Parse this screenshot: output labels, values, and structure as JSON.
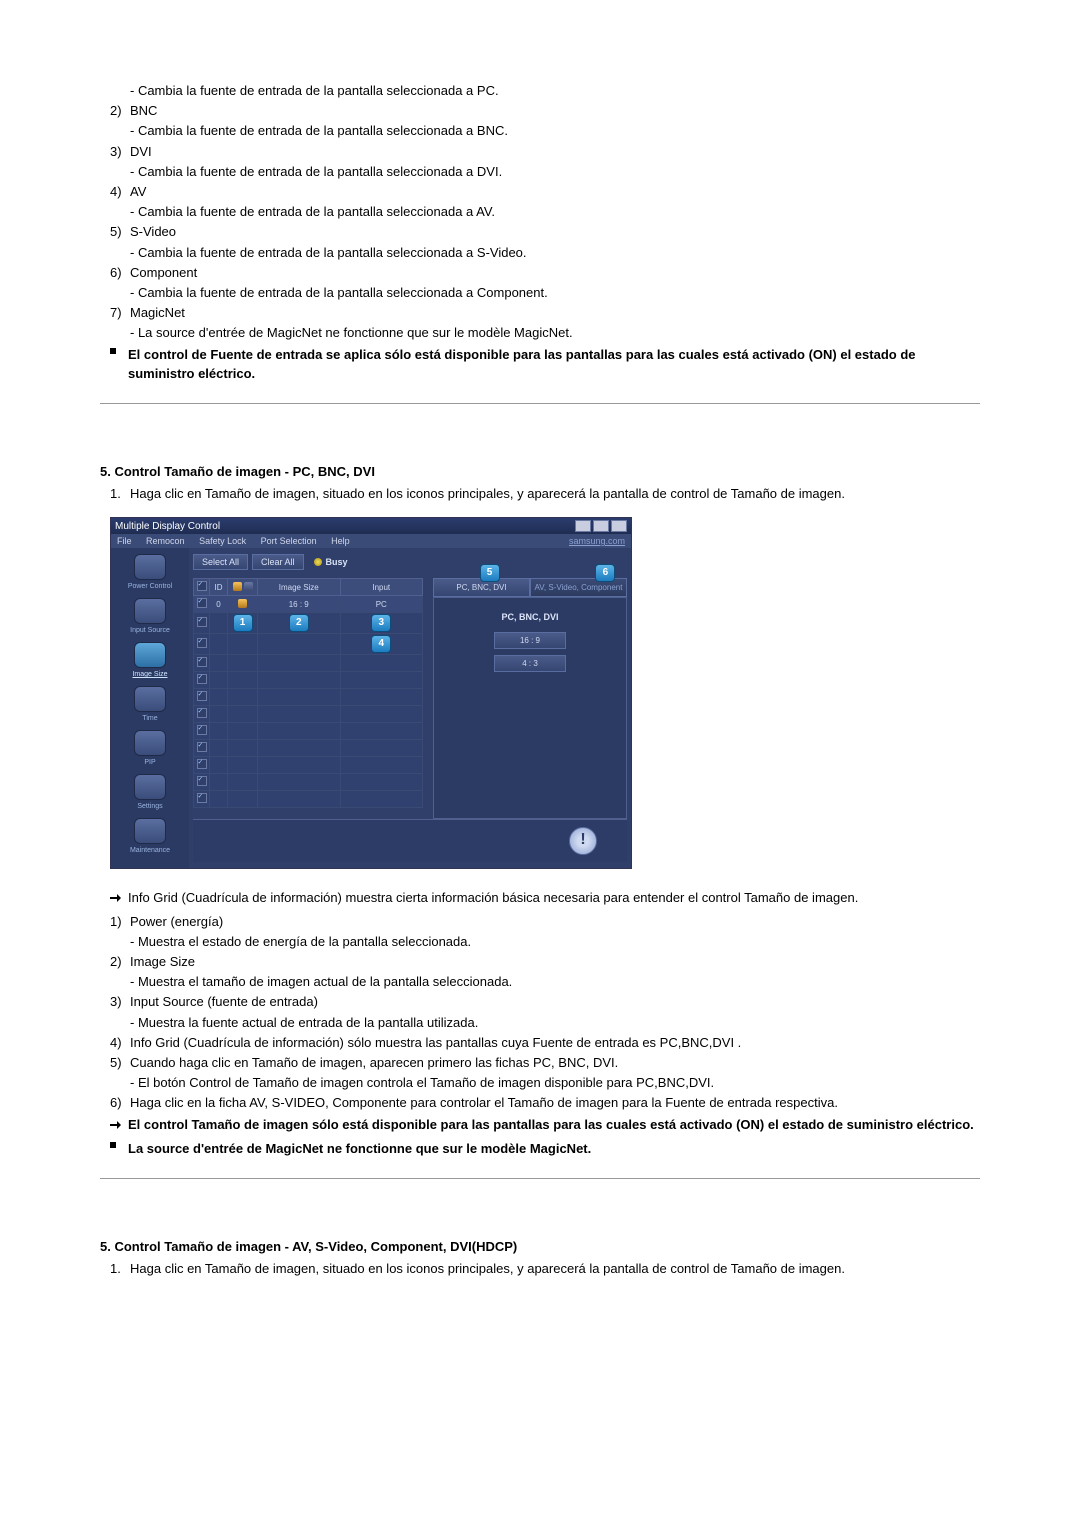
{
  "top_list": [
    {
      "sub": "- Cambia la fuente de entrada de la pantalla seleccionada a PC."
    },
    {
      "num": "2)",
      "label": "BNC",
      "sub": "- Cambia la fuente de entrada de la pantalla seleccionada a BNC."
    },
    {
      "num": "3)",
      "label": "DVI",
      "sub": "- Cambia la fuente de entrada de la pantalla seleccionada a DVI."
    },
    {
      "num": "4)",
      "label": "AV",
      "sub": "- Cambia la fuente de entrada de la pantalla seleccionada a AV."
    },
    {
      "num": "5)",
      "label": "S-Video",
      "sub": "- Cambia la fuente de entrada de la pantalla seleccionada a S-Video."
    },
    {
      "num": "6)",
      "label": "Component",
      "sub": "- Cambia la fuente de entrada de la pantalla seleccionada a Component."
    },
    {
      "num": "7)",
      "label": "MagicNet",
      "sub": "- La source d'entrée de MagicNet ne fonctionne que sur le modèle MagicNet."
    }
  ],
  "top_note": "El control de Fuente de entrada se aplica sólo está disponible para las pantallas para las cuales está activado (ON) el estado de suministro eléctrico.",
  "section5a": {
    "heading": "5. Control Tamaño de imagen - PC, BNC, DVI",
    "para_num": "1.",
    "para": "Haga clic en Tamaño de imagen, situado en los iconos principales, y aparecerá la pantalla de control de Tamaño de imagen."
  },
  "shot": {
    "title": "Multiple Display Control",
    "menus": [
      "File",
      "Remocon",
      "Safety Lock",
      "Port Selection",
      "Help"
    ],
    "menu_right": "samsung.com",
    "sidebar": [
      {
        "label": "Power Control"
      },
      {
        "label": "Input Source"
      },
      {
        "label": "Image Size",
        "selected": true
      },
      {
        "label": "Time"
      },
      {
        "label": "PIP"
      },
      {
        "label": "Settings"
      },
      {
        "label": "Maintenance"
      }
    ],
    "buttons": {
      "select_all": "Select All",
      "clear_all": "Clear All",
      "busy": "Busy"
    },
    "table_headers": [
      "",
      "ID",
      "",
      "Image Size",
      "Input"
    ],
    "row1": {
      "id": "0",
      "size": "16 : 9",
      "input": "PC"
    },
    "badges": {
      "b1": "1",
      "b2": "2",
      "b3": "3",
      "b4": "4",
      "b5": "5",
      "b6": "6"
    },
    "blank_rows": 10,
    "tabs": {
      "left": "PC, BNC, DVI",
      "right": "AV, S-Video, Component"
    },
    "panel": {
      "title": "PC, BNC, DVI",
      "btn1": "16 : 9",
      "btn2": "4 : 3"
    },
    "info_icon": "!"
  },
  "after_shot": {
    "intro_bullet": "Info Grid (Cuadrícula de información) muestra cierta información básica necesaria para entender el control Tamaño de imagen.",
    "items": [
      {
        "num": "1)",
        "label": "Power (energía)",
        "sub": "- Muestra el estado de energía de la pantalla seleccionada."
      },
      {
        "num": "2)",
        "label": "Image Size",
        "sub": "- Muestra el tamaño de imagen actual de la pantalla seleccionada."
      },
      {
        "num": "3)",
        "label": "Input Source (fuente de entrada)",
        "sub": "- Muestra la fuente actual de entrada de la pantalla utilizada."
      },
      {
        "num": "4)",
        "label": "Info Grid (Cuadrícula de información) sólo muestra las pantallas cuya Fuente de entrada es PC,BNC,DVI ."
      },
      {
        "num": "5)",
        "label": "Cuando haga clic en Tamaño de imagen, aparecen primero las fichas PC, BNC, DVI.",
        "sub": "- El botón Control de Tamaño de imagen controla el Tamaño de imagen disponible para PC,BNC,DVI."
      },
      {
        "num": "6)",
        "label": "Haga clic en la ficha AV, S-VIDEO, Componente para controlar el Tamaño de imagen para la Fuente de entrada respectiva."
      }
    ],
    "note1": "El control Tamaño de imagen sólo está disponible para las pantallas para las cuales está activado (ON) el estado de suministro eléctrico.",
    "note2": "La source d'entrée de MagicNet ne fonctionne que sur le modèle MagicNet."
  },
  "section5b": {
    "heading": "5. Control Tamaño de imagen - AV, S-Video, Component, DVI(HDCP)",
    "para_num": "1.",
    "para": "Haga clic en Tamaño de imagen, situado en los iconos principales, y aparecerá la pantalla de control de Tamaño de imagen."
  }
}
